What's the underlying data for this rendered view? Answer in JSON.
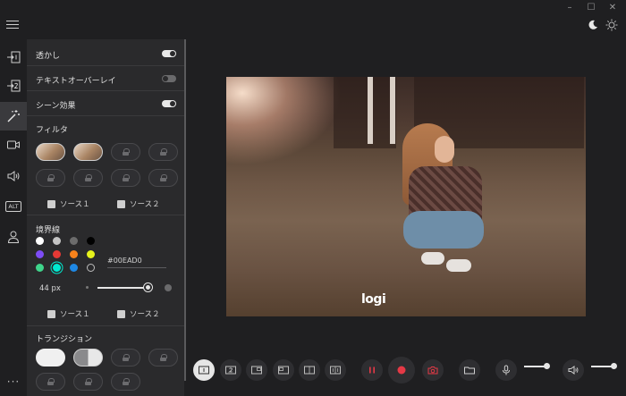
{
  "window": {
    "minimize_label": "–",
    "maximize_label": "☐",
    "close_label": "✕"
  },
  "rail": {
    "items": [
      "source-1-input",
      "source-2-input",
      "effects",
      "camera",
      "audio",
      "alt-text",
      "account"
    ],
    "active": "effects",
    "alt_label": "ALT",
    "more_label": "···"
  },
  "panel": {
    "toggles": [
      {
        "label": "透かし",
        "state": "on"
      },
      {
        "label": "テキストオーバーレイ",
        "state": "off"
      },
      {
        "label": "シーン効果",
        "state": "on"
      }
    ],
    "filter": {
      "title": "フィルタ",
      "source1": "ソース１",
      "source2": "ソース２"
    },
    "border": {
      "title": "境界線",
      "colors": [
        "#ffffff",
        "#c4c4c4",
        "#6c6c6c",
        "#000000",
        "#7d4cf5",
        "#e53935",
        "#f7821b",
        "#e6f21c",
        "#3fd48b",
        "#00EAD0",
        "#1e88e5",
        "#2a2a2c"
      ],
      "selected_color": "#00EAD0",
      "hex_value": "#00EAD0",
      "width_label": "44 px",
      "width_value": 44,
      "source1": "ソース１",
      "source2": "ソース２"
    },
    "transition": {
      "title": "トランジション"
    }
  },
  "preview": {
    "watermark": "logi"
  },
  "toolbar": {
    "layouts": [
      "1",
      "2",
      "1-2",
      "2-1",
      "1|2",
      "1||1"
    ],
    "active_layout": "1"
  },
  "colors": {
    "accent": "#00EAD0",
    "record": "#e53946",
    "panel_bg": "#2a2a2c",
    "app_bg": "#1f1f21"
  }
}
